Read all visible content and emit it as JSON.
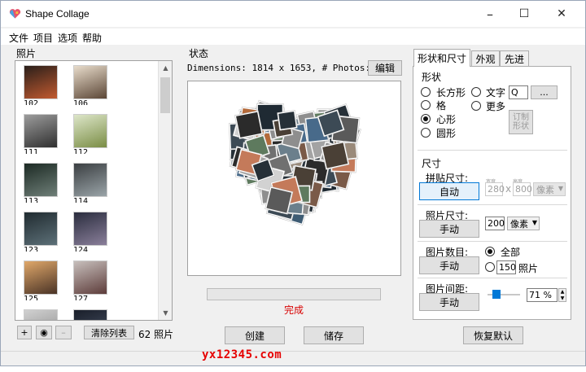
{
  "window": {
    "title": "Shape Collage",
    "min": "–",
    "max": "☐",
    "close": "✕"
  },
  "menu": [
    "文件",
    "项目",
    "选项",
    "帮助"
  ],
  "photos": {
    "label": "照片",
    "items": [
      {
        "n": "102",
        "c1": "#2a1f1a",
        "c2": "#c25a30"
      },
      {
        "n": "106",
        "c1": "#e8dccb",
        "c2": "#5b4636"
      },
      {
        "n": "111",
        "c1": "#9c9c9c",
        "c2": "#2f2f2f"
      },
      {
        "n": "112",
        "c1": "#dde6c9",
        "c2": "#7a8d45"
      },
      {
        "n": "113",
        "c1": "#1c2a24",
        "c2": "#6f7f78"
      },
      {
        "n": "114",
        "c1": "#3b3f42",
        "c2": "#9aa4a8"
      },
      {
        "n": "123",
        "c1": "#202b30",
        "c2": "#5d7078"
      },
      {
        "n": "124",
        "c1": "#2a2d3e",
        "c2": "#8a7f9a"
      },
      {
        "n": "125",
        "c1": "#e0a86a",
        "c2": "#4a3326"
      },
      {
        "n": "127",
        "c1": "#c7bfbc",
        "c2": "#5d3c3a"
      },
      {
        "n": "",
        "c1": "#d0d0d0",
        "c2": "#8a8a8a"
      },
      {
        "n": "",
        "c1": "#1a1f2a",
        "c2": "#4a5468"
      }
    ],
    "add": "+",
    "web": "◉",
    "remove": "–",
    "clear": "清除列表",
    "count": "62 照片"
  },
  "status": {
    "label": "状态",
    "dimensions": "Dimensions: 1814 x 1653, # Photos: 62",
    "edit": "编辑",
    "done": "完成",
    "progress": 0
  },
  "actions": {
    "create": "创建",
    "save": "储存",
    "reset": "恢复默认"
  },
  "tabs": [
    "形状和尺寸",
    "外观",
    "先进"
  ],
  "shape": {
    "label": "形状",
    "rect": "长方形",
    "grid": "格",
    "heart": "心形",
    "circle": "圆形",
    "text": "文字",
    "text_value": "Q",
    "text_more": "...",
    "more": "更多",
    "custom": "订制\n形状",
    "selected": "heart"
  },
  "size": {
    "label": "尺寸",
    "collage_size": "拼贴尺寸:",
    "auto": "自动",
    "width_hint": "宽度",
    "height_hint": "高度",
    "width": "280",
    "x": "x",
    "height": "800",
    "unit": "像素",
    "photo_size": "照片尺寸:",
    "manual": "手动",
    "photo_px": "200",
    "photo_unit": "像素",
    "photo_count": "图片数目:",
    "count_manual": "手动",
    "all": "全部",
    "count_value": "150",
    "count_unit": "照片",
    "spacing": "图片间距:",
    "spacing_manual": "手动",
    "spacing_value": "71 %",
    "spacing_level": 0.2
  },
  "watermark": "yx12345.com"
}
